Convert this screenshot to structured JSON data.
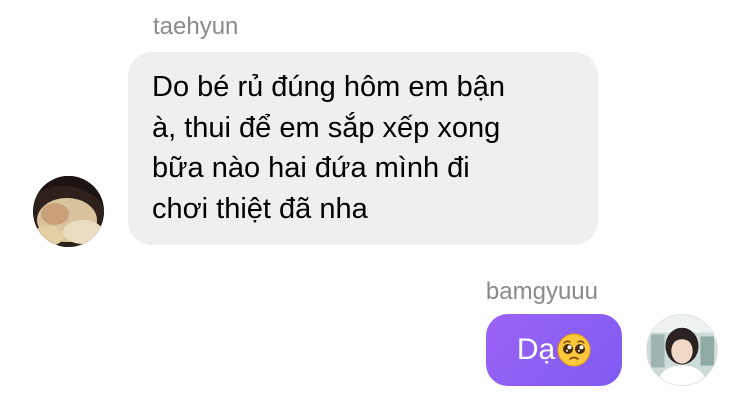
{
  "messages": [
    {
      "sender": "taehyun",
      "direction": "incoming",
      "lines": [
        "Do bé rủ đúng hôm em bận",
        "à, thui để em sắp xếp xong",
        "bữa nào hai đứa mình đi",
        "chơi thiệt đã nha"
      ]
    },
    {
      "sender": "bamgyuuu",
      "direction": "outgoing",
      "text": "Dạ",
      "emoji": "pleading-face-emoji"
    }
  ],
  "colors": {
    "incoming_bubble": "#efefef",
    "outgoing_bubble": "#8b5cf6",
    "sender_name": "#8a8a8e"
  }
}
